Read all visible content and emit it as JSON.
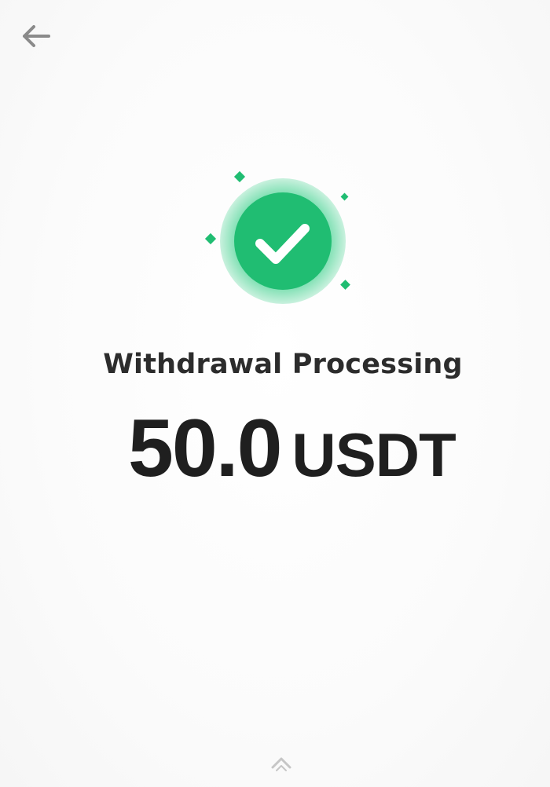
{
  "header": {
    "back_icon": "arrow-left-icon"
  },
  "status": {
    "icon": "check-circle-icon",
    "title": "Withdrawal Processing",
    "accent_color": "#21c07a"
  },
  "amount": {
    "value": "50.0",
    "currency": "USDT"
  },
  "footer": {
    "icon": "chevron-up-icon"
  }
}
